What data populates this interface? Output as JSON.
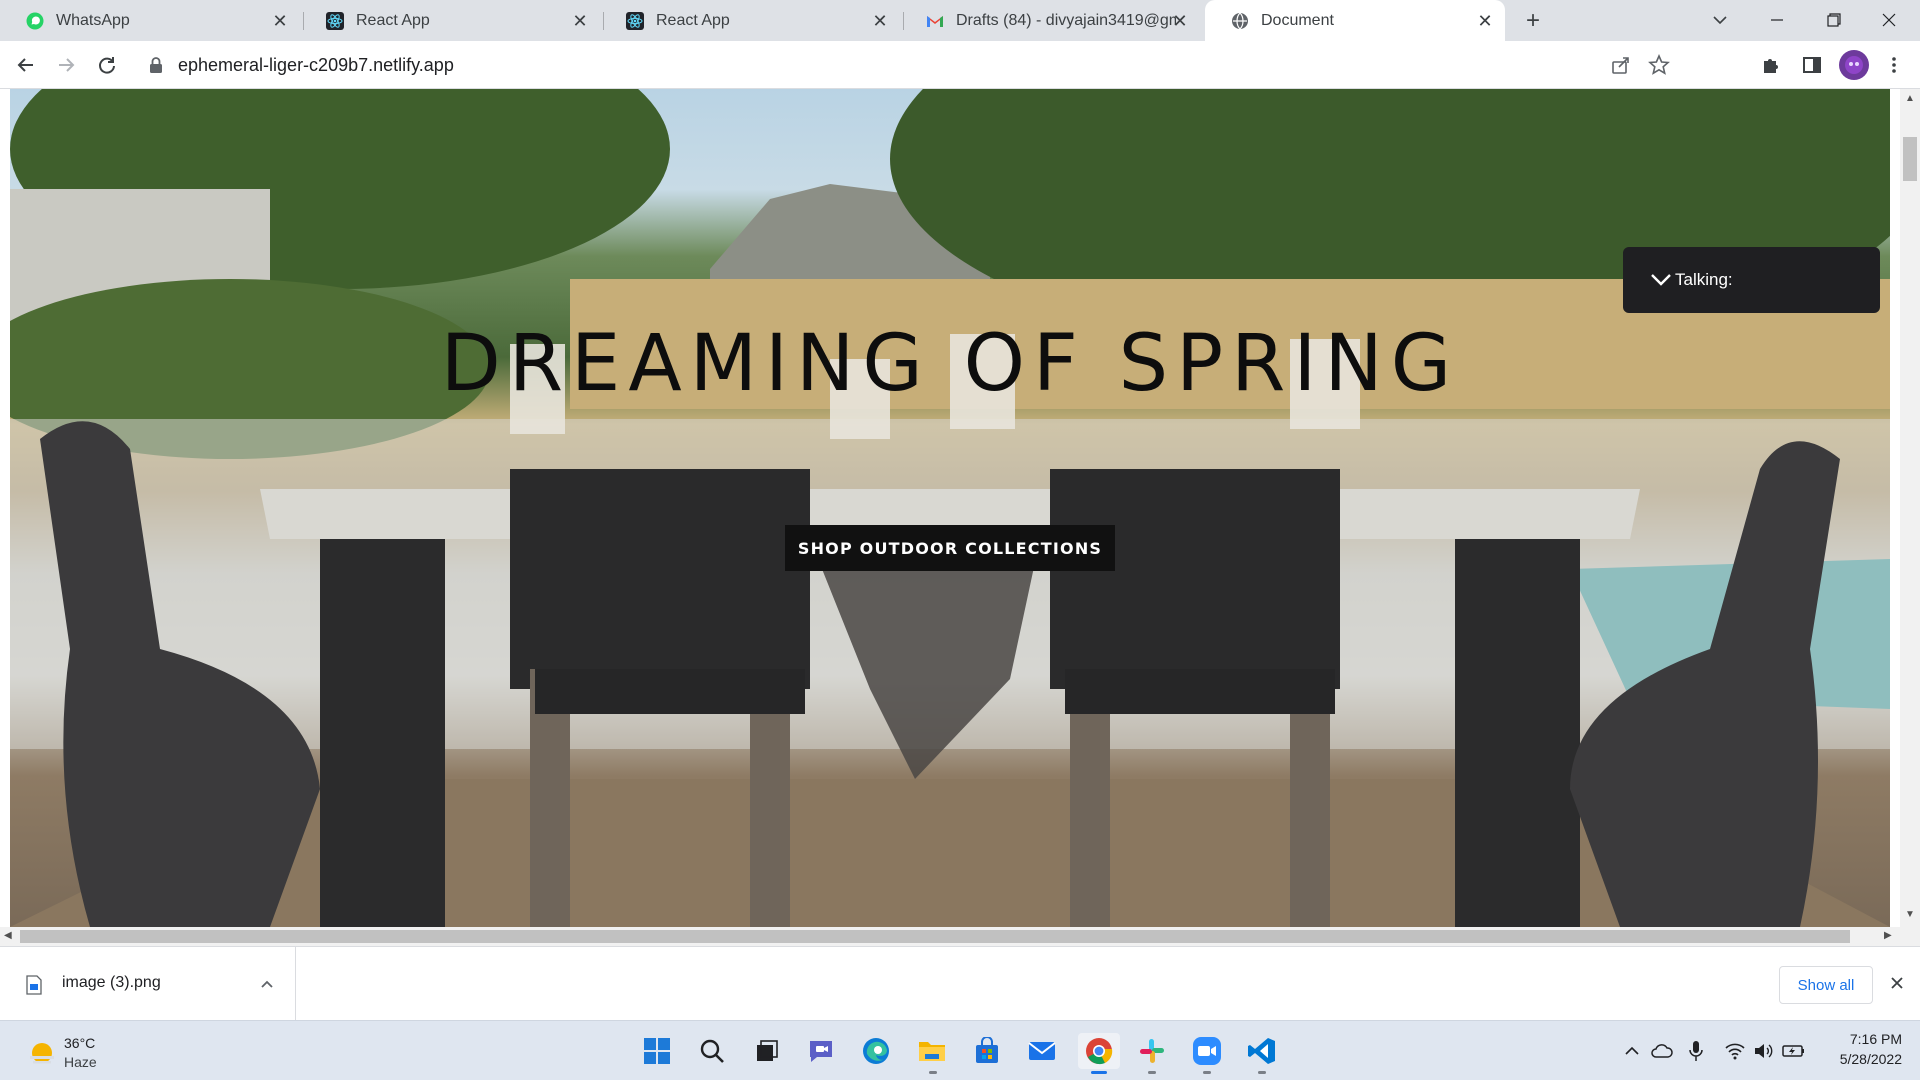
{
  "tabs": [
    {
      "title": "WhatsApp",
      "icon": "whatsapp-icon",
      "active": false
    },
    {
      "title": "React App",
      "icon": "react-icon",
      "active": false
    },
    {
      "title": "React App",
      "icon": "react-icon",
      "active": false
    },
    {
      "title": "Drafts (84) - divyajain3419@gma",
      "icon": "gmail-icon",
      "active": false
    },
    {
      "title": "Document",
      "icon": "globe-icon",
      "active": true
    }
  ],
  "toolbar": {
    "url": "ephemeral-liger-c209b7.netlify.app"
  },
  "hero": {
    "headline": "DREAMING OF SPRING",
    "cta_label": "SHOP OUTDOOR COLLECTIONS"
  },
  "talking_widget": {
    "label": "Talking:"
  },
  "download": {
    "filename": "image (3).png",
    "show_all": "Show all"
  },
  "taskbar": {
    "weather_temp": "36°C",
    "weather_desc": "Haze",
    "time": "7:16 PM",
    "date": "5/28/2022",
    "pinned": [
      "windows-start-icon",
      "search-icon",
      "task-view-icon",
      "teams-chat-icon",
      "edge-icon",
      "file-explorer-icon",
      "microsoft-store-icon",
      "mail-icon",
      "chrome-icon",
      "slack-icon",
      "zoom-icon",
      "vscode-icon"
    ]
  },
  "colors": {
    "tabstrip": "#dee1e6",
    "cta_bg": "#111111",
    "widget_bg": "#1f1f22",
    "accent_blue": "#1a73e8"
  }
}
